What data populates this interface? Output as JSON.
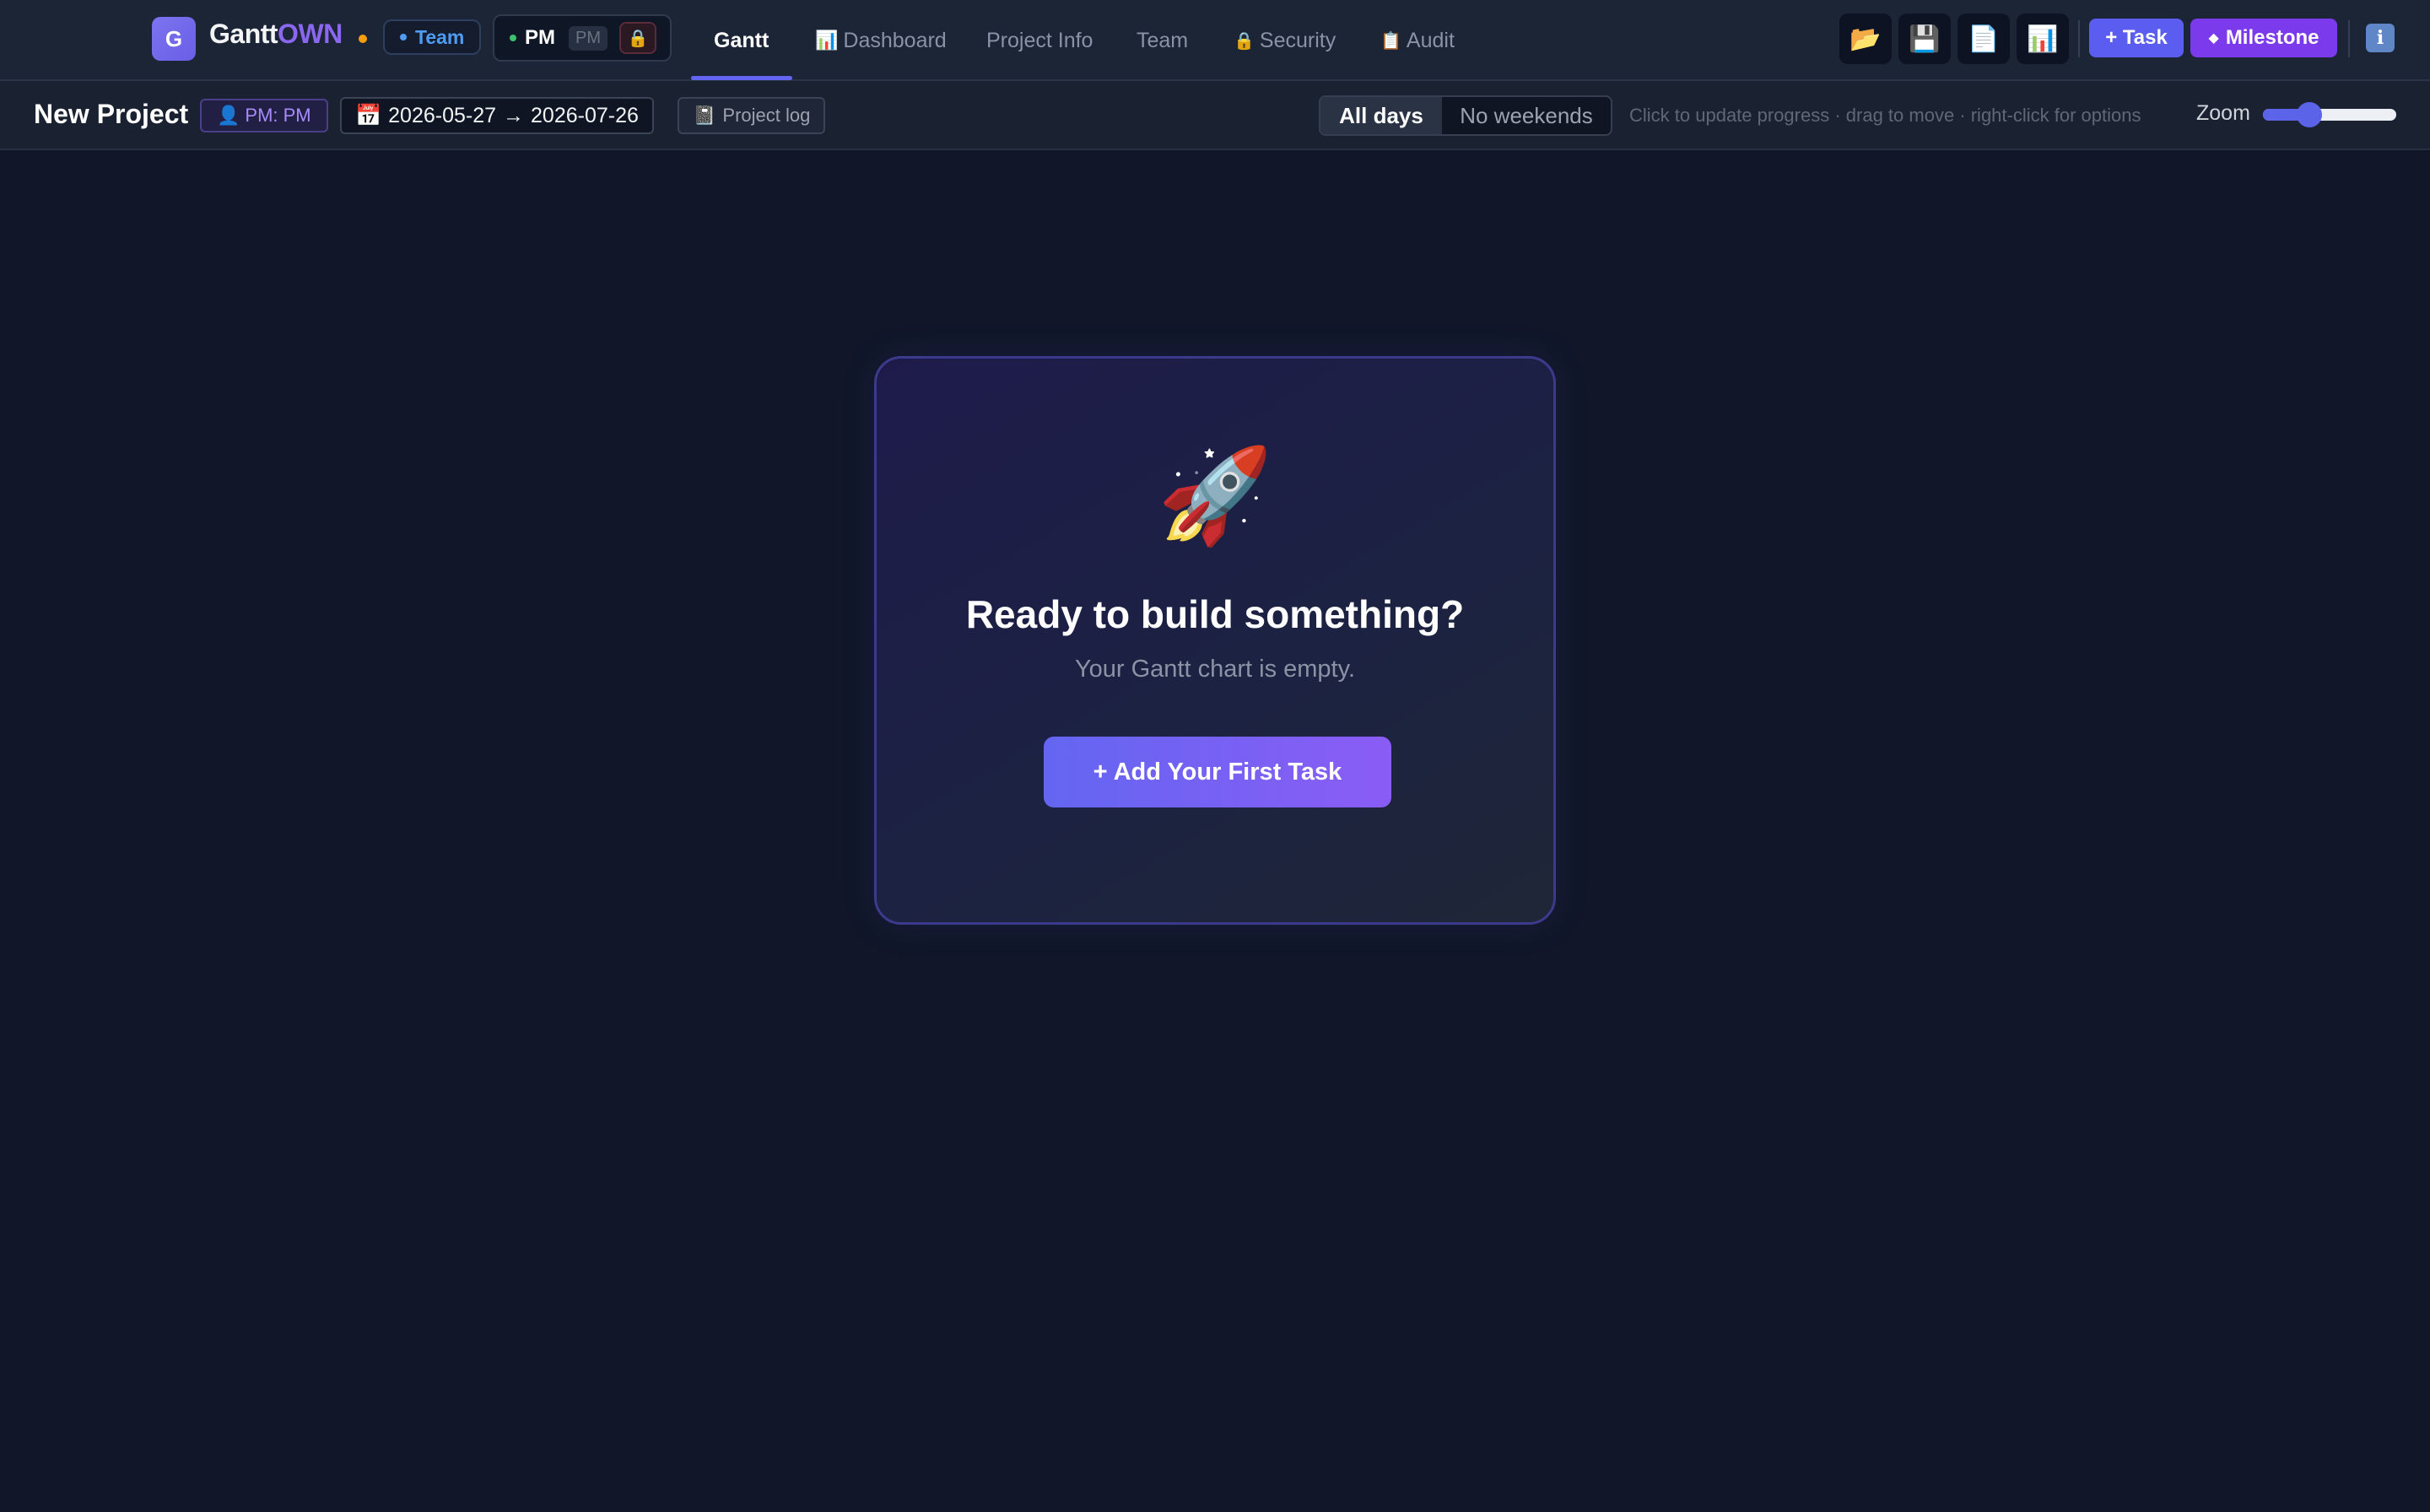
{
  "header": {
    "logo_letter": "G",
    "brand_main": "Gantt",
    "brand_accent": "OWN",
    "team_label": "Team",
    "role_label": "PM",
    "role_chip": "PM",
    "lock_icon": "lock-icon",
    "tabs": [
      {
        "label": "Gantt",
        "icon": "",
        "active": true
      },
      {
        "label": "Dashboard",
        "icon": "📊",
        "active": false
      },
      {
        "label": "Project Info",
        "icon": "",
        "active": false
      },
      {
        "label": "Team",
        "icon": "",
        "active": false
      },
      {
        "label": "Security",
        "icon": "🔒",
        "active": false
      },
      {
        "label": "Audit",
        "icon": "📋",
        "active": false
      }
    ],
    "toolbar_icons": [
      "folder-open-icon",
      "save-icon",
      "document-icon",
      "chart-icon"
    ],
    "add_task_label": "+ Task",
    "add_milestone_label": "Milestone",
    "milestone_icon": "◆",
    "info_label": "i"
  },
  "subbar": {
    "project_name": "New Project",
    "pm_badge": "PM: PM",
    "date_start": "2026-05-27",
    "date_arrow": "→",
    "date_end": "2026-07-26",
    "log_label": "Project log",
    "view_options": [
      "All days",
      "No weekends"
    ],
    "hint": "Click to update progress · drag to move · right-click for options",
    "zoom_label": "Zoom",
    "zoom_value": 0.35
  },
  "empty_state": {
    "icon": "🚀",
    "title": "Ready to build something?",
    "subtitle": "Your Gantt chart is empty.",
    "cta_label": "+ Add Your First Task"
  },
  "colors": {
    "background": "#111729",
    "accent": "#6366f1",
    "milestone": "#7c3aed",
    "brand_accent": "#8b67f0"
  }
}
